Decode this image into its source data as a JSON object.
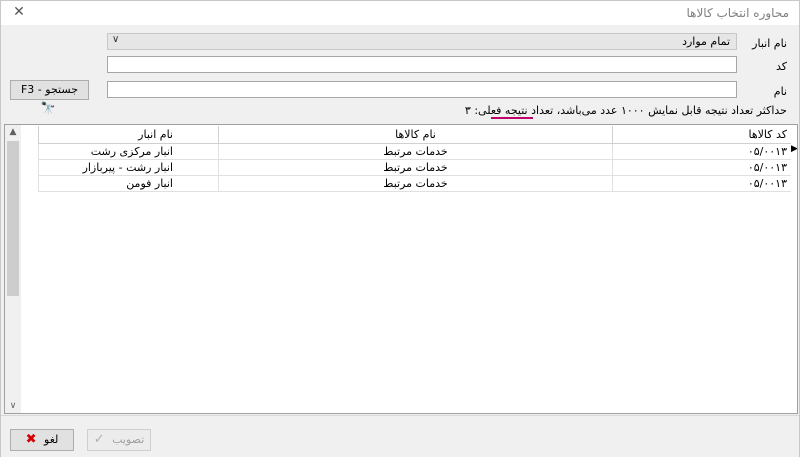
{
  "window": {
    "title": "محاوره انتخاب کالاها"
  },
  "filters": {
    "store_label": "نام انبار",
    "store_value": "تمام موارد",
    "code_label": "کد",
    "code_value": "",
    "name_label": "نام",
    "name_value": ""
  },
  "search_button": {
    "label": "جستجو - F3"
  },
  "info": {
    "text": "حداکثر تعداد نتیجه قابل نمایش ۱۰۰۰ عدد می‌باشد، تعداد نتیجه فعلی: ۳"
  },
  "table": {
    "headers": {
      "code": "کد کالاها",
      "name": "نام کالاها",
      "store": "نام انبار"
    },
    "rows": [
      {
        "code": "۰۵/۰۰۱۳",
        "name": "خدمات مرتبط",
        "store": "انبار مرکزی رشت"
      },
      {
        "code": "۰۵/۰۰۱۳",
        "name": "خدمات مرتبط",
        "store": "انبار رشت - پیربازار"
      },
      {
        "code": "۰۵/۰۰۱۳",
        "name": "خدمات مرتبط",
        "store": "انبار فومن"
      }
    ]
  },
  "buttons": {
    "approve": "تصویب",
    "cancel": "لغو"
  },
  "colors": {
    "accent_underline": "#c0006a",
    "cancel_icon": "#d40000"
  },
  "icons": [
    "close-icon",
    "binoculars-icon",
    "chevron-down-icon",
    "row-pointer-icon",
    "check-icon",
    "cancel-x-icon"
  ]
}
